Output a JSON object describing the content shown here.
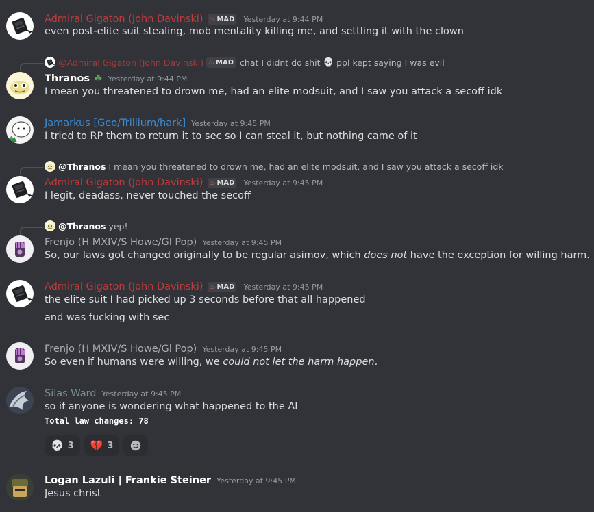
{
  "messages": [
    {
      "author": "Admiral Gigaton (John Davinski)",
      "tag": "MAD",
      "time": "Yesterday at 9:44 PM",
      "lines": [
        "even post-elite suit stealing, mob mentality killing me, and settling it with the clown"
      ]
    },
    {
      "reply": {
        "name": "@Admiral Gigaton (John Davinski)",
        "tag": "MAD",
        "text": "chat I didnt do shit",
        "text2": "ppl kept saying I was evil",
        "emoji": "skull-emoji"
      },
      "author": "Thranos",
      "time": "Yesterday at 9:44 PM",
      "lines": [
        "I mean you threatened to drown me, had an elite modsuit, and I saw you attack a secoff idk"
      ]
    },
    {
      "author": "Jamarkus [Geo/Trillium/hark]",
      "time": "Yesterday at 9:45 PM",
      "lines": [
        "I tried to RP them to return it to sec so I can steal it, but nothing came of it"
      ]
    },
    {
      "reply": {
        "name": "@Thranos",
        "text": "I mean you threatened to drown me, had an elite modsuit, and I saw you attack a secoff idk"
      },
      "author": "Admiral Gigaton (John Davinski)",
      "tag": "MAD",
      "time": "Yesterday at 9:45 PM",
      "lines": [
        "I legit, deadass, never touched the secoff"
      ]
    },
    {
      "reply": {
        "name": "@Thranos",
        "text": "yep!"
      },
      "author": "Frenjo (H MXIV/S Howe/Gl Pop)",
      "time": "Yesterday at 9:45 PM",
      "line_a": "So, our laws got changed originally to be regular asimov, which ",
      "line_em": "does not",
      "line_b": " have the exception for willing harm."
    },
    {
      "author": "Admiral Gigaton (John Davinski)",
      "tag": "MAD",
      "time": "Yesterday at 9:45 PM",
      "lines": [
        "the elite suit I had picked up 3 seconds before that all happened",
        "and was fucking with sec"
      ]
    },
    {
      "author": "Frenjo (H MXIV/S Howe/Gl Pop)",
      "time": "Yesterday at 9:45 PM",
      "line_a": "So even if humans were willing, we ",
      "line_em": "could not let the harm happen",
      "line_b": "."
    },
    {
      "author": "Silas Ward",
      "time": "Yesterday at 9:45 PM",
      "lines": [
        "so if anyone is wondering what happened to the AI"
      ],
      "embed": "Total law changes: 78",
      "reactions": [
        {
          "emoji": "💀",
          "icon": "skull-emoji",
          "count": "3"
        },
        {
          "emoji": "💔",
          "icon": "broken-heart-emoji",
          "count": "3"
        }
      ],
      "add_reaction_icon": "add-reaction-icon"
    },
    {
      "author": "Logan Lazuli | Frankie Steiner",
      "time": "Yesterday at 9:45 PM",
      "lines": [
        "Jesus christ"
      ]
    }
  ],
  "colors": {
    "background": "#313338",
    "admiral": "#c23b3b",
    "thranos": "#f2f3f5",
    "jamarkus": "#3b8ed8",
    "frenjo": "#a8adb5",
    "silas": "#7a8d99",
    "logan": "#ffffff",
    "timestamp": "#949ba4",
    "text": "#dbdee1"
  }
}
